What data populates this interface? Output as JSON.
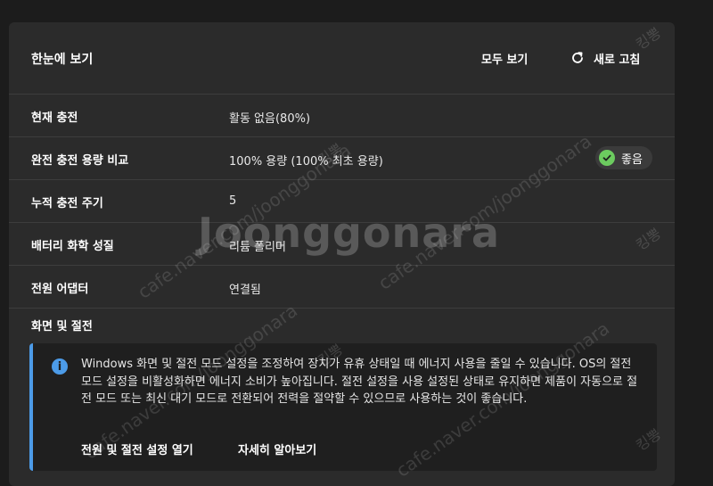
{
  "header": {
    "title": "한눈에 보기",
    "view_all_label": "모두 보기",
    "refresh_label": "새로 고침"
  },
  "rows": [
    {
      "label": "현재 충전",
      "value": "활동 없음(80%)"
    },
    {
      "label": "완전 충전 용량 비교",
      "value": "100% 용량 (100% 최초 용량)",
      "badge": "좋음"
    },
    {
      "label": "누적 충전 주기",
      "value": "5"
    },
    {
      "label": "배터리 화학 성질",
      "value": "리튬 폴리머"
    },
    {
      "label": "전원 어댑터",
      "value": "연결됨"
    }
  ],
  "section": {
    "title": "화면 및 절전",
    "info_text": "Windows 화면 및 절전 모드 설정을 조정하여 장치가 유휴 상태일 때 에너지 사용을 줄일 수 있습니다. OS의 절전 모드 설정을 비활성화하면 에너지 소비가 높아집니다. 절전 설정을 사용 설정된 상태로 유지하면 제품이 자동으로 절전 모드 또는 최신 대기 모드로 전환되어 전력을 절약할 수 있으므로 사용하는 것이 좋습니다.",
    "link_open": "전원 및 절전 설정 열기",
    "link_learn": "자세히 알아보기"
  },
  "watermark": {
    "brand": "Joonggonara",
    "url": "cafe.naver.com/joonggonara",
    "tag": "킹뽕"
  },
  "colors": {
    "background": "#1c1c1c",
    "panel": "#2b2b2b",
    "accent": "#4c9be8",
    "good": "#6ccb5f"
  }
}
